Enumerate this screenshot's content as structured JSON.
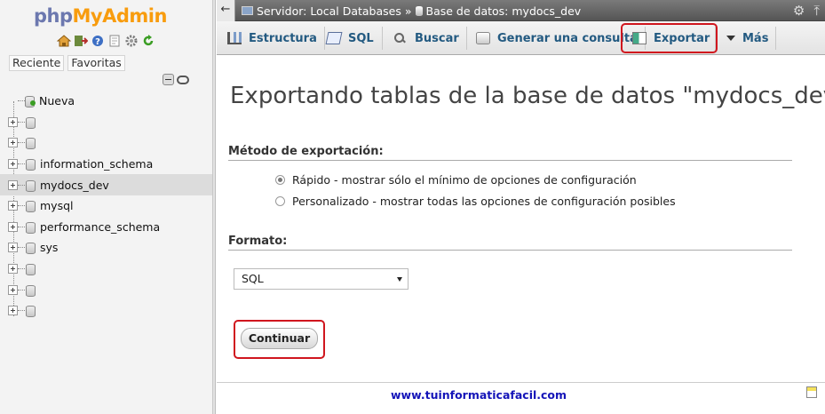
{
  "sidebar": {
    "logo": {
      "php": "php",
      "my": "My",
      "admin": "Admin"
    },
    "quick_icons": [
      "home-icon",
      "exit-icon",
      "help-icon",
      "docs-icon",
      "settings-icon",
      "reload-icon"
    ],
    "tabs": [
      "Reciente",
      "Favoritas"
    ],
    "tree": [
      {
        "kind": "new",
        "label": "Nueva"
      },
      {
        "kind": "db",
        "label": ""
      },
      {
        "kind": "db",
        "label": ""
      },
      {
        "kind": "db",
        "label": "information_schema"
      },
      {
        "kind": "db",
        "label": "mydocs_dev",
        "selected": true
      },
      {
        "kind": "db",
        "label": "mysql"
      },
      {
        "kind": "db",
        "label": "performance_schema"
      },
      {
        "kind": "db",
        "label": "sys"
      },
      {
        "kind": "db",
        "label": ""
      },
      {
        "kind": "db",
        "label": ""
      },
      {
        "kind": "db",
        "label": ""
      }
    ]
  },
  "topbar": {
    "server_label": "Servidor: Local Databases",
    "separator": "»",
    "db_label": "Base de datos: mydocs_dev",
    "gear_icon": "⚙",
    "collapse_icon": "⤒"
  },
  "tabs": {
    "estructura": "Estructura",
    "sql": "SQL",
    "buscar": "Buscar",
    "generar": "Generar una consulta",
    "exportar": "Exportar",
    "mas": "Más"
  },
  "main": {
    "title": "Exportando tablas de la base de datos \"mydocs_dev\"",
    "method_heading": "Método de exportación:",
    "method_quick": "Rápido - mostrar sólo el mínimo de opciones de configuración",
    "method_custom": "Personalizado - mostrar todas las opciones de configuración posibles",
    "method_selected": "quick",
    "format_heading": "Formato:",
    "format_value": "SQL",
    "continue_button": "Continuar",
    "footer": "www.tuinformaticafacil.com"
  },
  "colors": {
    "highlight": "#d0161e",
    "tab_text": "#235a81",
    "footer_link": "#1414b8"
  }
}
